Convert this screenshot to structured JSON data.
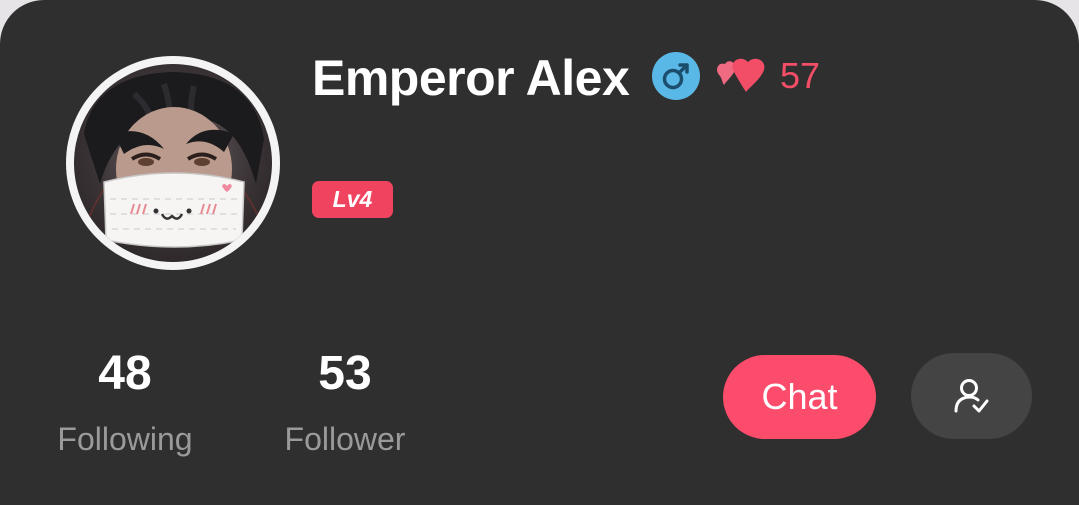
{
  "profile": {
    "name": "Emperor Alex",
    "gender_icon": "male-symbol-icon",
    "hearts_icon": "hearts-icon",
    "heart_count": "57",
    "level": "Lv4"
  },
  "stats": {
    "following_count": "48",
    "following_label": "Following",
    "follower_count": "53",
    "follower_label": "Follower"
  },
  "actions": {
    "chat_label": "Chat",
    "follow_icon": "user-check-icon"
  },
  "colors": {
    "card_background": "#2f2f2f",
    "accent_pink": "#fb4d6b",
    "heart_count": "#f24e68",
    "gender_blue": "#5ab8e6",
    "muted_text": "#9a9a9a"
  }
}
